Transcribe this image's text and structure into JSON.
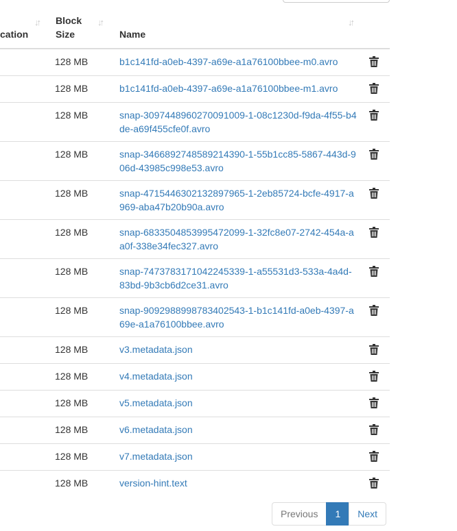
{
  "table": {
    "headers": {
      "location": "cation",
      "block_size": "Block Size",
      "name": "Name"
    },
    "rows": [
      {
        "size": "128 MB",
        "name": "b1c141fd-a0eb-4397-a69e-a1a76100bbee-m0.avro"
      },
      {
        "size": "128 MB",
        "name": "b1c141fd-a0eb-4397-a69e-a1a76100bbee-m1.avro"
      },
      {
        "size": "128 MB",
        "name": "snap-3097448960270091009-1-08c1230d-f9da-4f55-b4de-a69f455cfe0f.avro"
      },
      {
        "size": "128 MB",
        "name": "snap-3466892748589214390-1-55b1cc85-5867-443d-906d-43985c998e53.avro"
      },
      {
        "size": "128 MB",
        "name": "snap-4715446302132897965-1-2eb85724-bcfe-4917-a969-aba47b20b90a.avro"
      },
      {
        "size": "128 MB",
        "name": "snap-6833504853995472099-1-32fc8e07-2742-454a-aa0f-338e34fec327.avro"
      },
      {
        "size": "128 MB",
        "name": "snap-7473783171042245339-1-a55531d3-533a-4a4d-83bd-9b3cb6d2ce31.avro"
      },
      {
        "size": "128 MB",
        "name": "snap-9092988998783402543-1-b1c141fd-a0eb-4397-a69e-a1a76100bbee.avro"
      },
      {
        "size": "128 MB",
        "name": "v3.metadata.json"
      },
      {
        "size": "128 MB",
        "name": "v4.metadata.json"
      },
      {
        "size": "128 MB",
        "name": "v5.metadata.json"
      },
      {
        "size": "128 MB",
        "name": "v6.metadata.json"
      },
      {
        "size": "128 MB",
        "name": "v7.metadata.json"
      },
      {
        "size": "128 MB",
        "name": "version-hint.text"
      }
    ]
  },
  "pagination": {
    "previous": "Previous",
    "current": "1",
    "next": "Next"
  },
  "icons": {
    "sort": "sort-icon",
    "delete": "trash-icon"
  },
  "colors": {
    "link": "#337ab7",
    "active_page": "#337ab7"
  }
}
